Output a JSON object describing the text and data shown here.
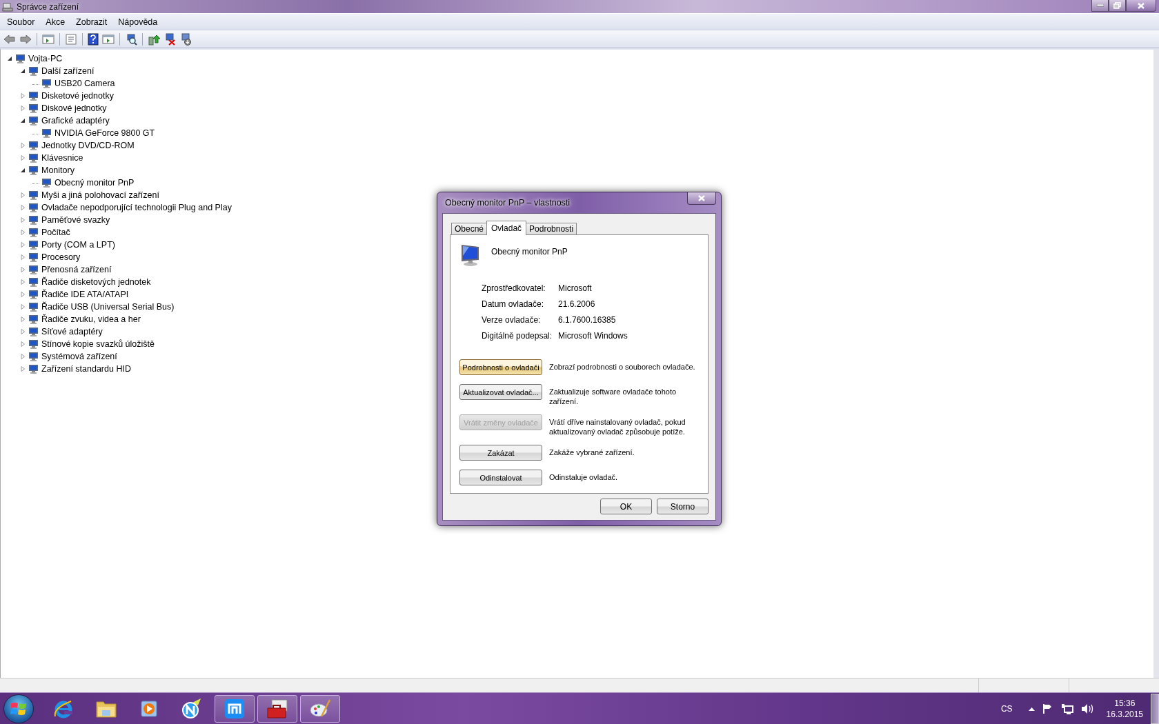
{
  "window": {
    "title": "Správce zařízení"
  },
  "menu": [
    "Soubor",
    "Akce",
    "Zobrazit",
    "Nápověda"
  ],
  "tree": {
    "label": "Vojta-PC",
    "expanded": true,
    "children": [
      {
        "label": "Další zařízení",
        "expanded": true,
        "children": [
          {
            "label": "USB20 Camera"
          }
        ]
      },
      {
        "label": "Disketové jednotky",
        "expanded": false
      },
      {
        "label": "Diskové jednotky",
        "expanded": false
      },
      {
        "label": "Grafické adaptéry",
        "expanded": true,
        "children": [
          {
            "label": "NVIDIA GeForce 9800 GT"
          }
        ]
      },
      {
        "label": "Jednotky DVD/CD-ROM",
        "expanded": false
      },
      {
        "label": "Klávesnice",
        "expanded": false
      },
      {
        "label": "Monitory",
        "expanded": true,
        "children": [
          {
            "label": "Obecný monitor PnP"
          }
        ]
      },
      {
        "label": "Myši a jiná polohovací zařízení",
        "expanded": false
      },
      {
        "label": "Ovladače nepodporující technologii Plug and Play",
        "expanded": false
      },
      {
        "label": "Paměťové svazky",
        "expanded": false
      },
      {
        "label": "Počítač",
        "expanded": false
      },
      {
        "label": "Porty (COM a LPT)",
        "expanded": false
      },
      {
        "label": "Procesory",
        "expanded": false
      },
      {
        "label": "Přenosná zařízení",
        "expanded": false
      },
      {
        "label": "Řadiče disketových jednotek",
        "expanded": false
      },
      {
        "label": "Řadiče IDE ATA/ATAPI",
        "expanded": false
      },
      {
        "label": "Řadiče USB (Universal Serial Bus)",
        "expanded": false
      },
      {
        "label": "Řadiče zvuku, videa a her",
        "expanded": false
      },
      {
        "label": "Síťové adaptéry",
        "expanded": false
      },
      {
        "label": "Stínové kopie svazků úložiště",
        "expanded": false
      },
      {
        "label": "Systémová zařízení",
        "expanded": false
      },
      {
        "label": "Zařízení standardu HID",
        "expanded": false
      }
    ]
  },
  "dialog": {
    "title": "Obecný monitor PnP – vlastnosti",
    "tabs": [
      {
        "label": "Obecné",
        "selected": false
      },
      {
        "label": "Ovladač",
        "selected": true
      },
      {
        "label": "Podrobnosti",
        "selected": false
      }
    ],
    "device_name": "Obecný monitor PnP",
    "properties": [
      {
        "label": "Zprostředkovatel:",
        "value": "Microsoft"
      },
      {
        "label": "Datum ovladače:",
        "value": "21.6.2006"
      },
      {
        "label": "Verze ovladače:",
        "value": "6.1.7600.16385"
      },
      {
        "label": "Digitálně podepsal:",
        "value": "Microsoft Windows"
      }
    ],
    "actions": [
      {
        "label": "Podrobnosti o ovladači",
        "description": "Zobrazí podrobnosti o souborech ovladače.",
        "disabled": false,
        "highlighted": true
      },
      {
        "label": "Aktualizovat ovladač...",
        "description": "Zaktualizuje software ovladače tohoto zařízení.",
        "disabled": false,
        "highlighted": false
      },
      {
        "label": "Vrátit změny ovladače",
        "description": "Vrátí dříve nainstalovaný ovladač, pokud aktualizovaný ovladač způsobuje potíže.",
        "disabled": true,
        "highlighted": false
      },
      {
        "label": "Zakázat",
        "description": "Zakáže vybrané zařízení.",
        "disabled": false,
        "highlighted": false
      },
      {
        "label": "Odinstalovat",
        "description": "Odinstaluje ovladač.",
        "disabled": false,
        "highlighted": false
      }
    ],
    "buttons": [
      "OK",
      "Storno"
    ]
  },
  "taskbar": {
    "items": [
      {
        "running": false
      },
      {
        "running": false
      },
      {
        "running": false
      },
      {
        "running": false
      },
      {
        "running": true
      },
      {
        "running": true
      },
      {
        "running": true
      }
    ]
  },
  "tray": {
    "language": "CS",
    "time": "15:36",
    "date": "16.3.2015"
  }
}
